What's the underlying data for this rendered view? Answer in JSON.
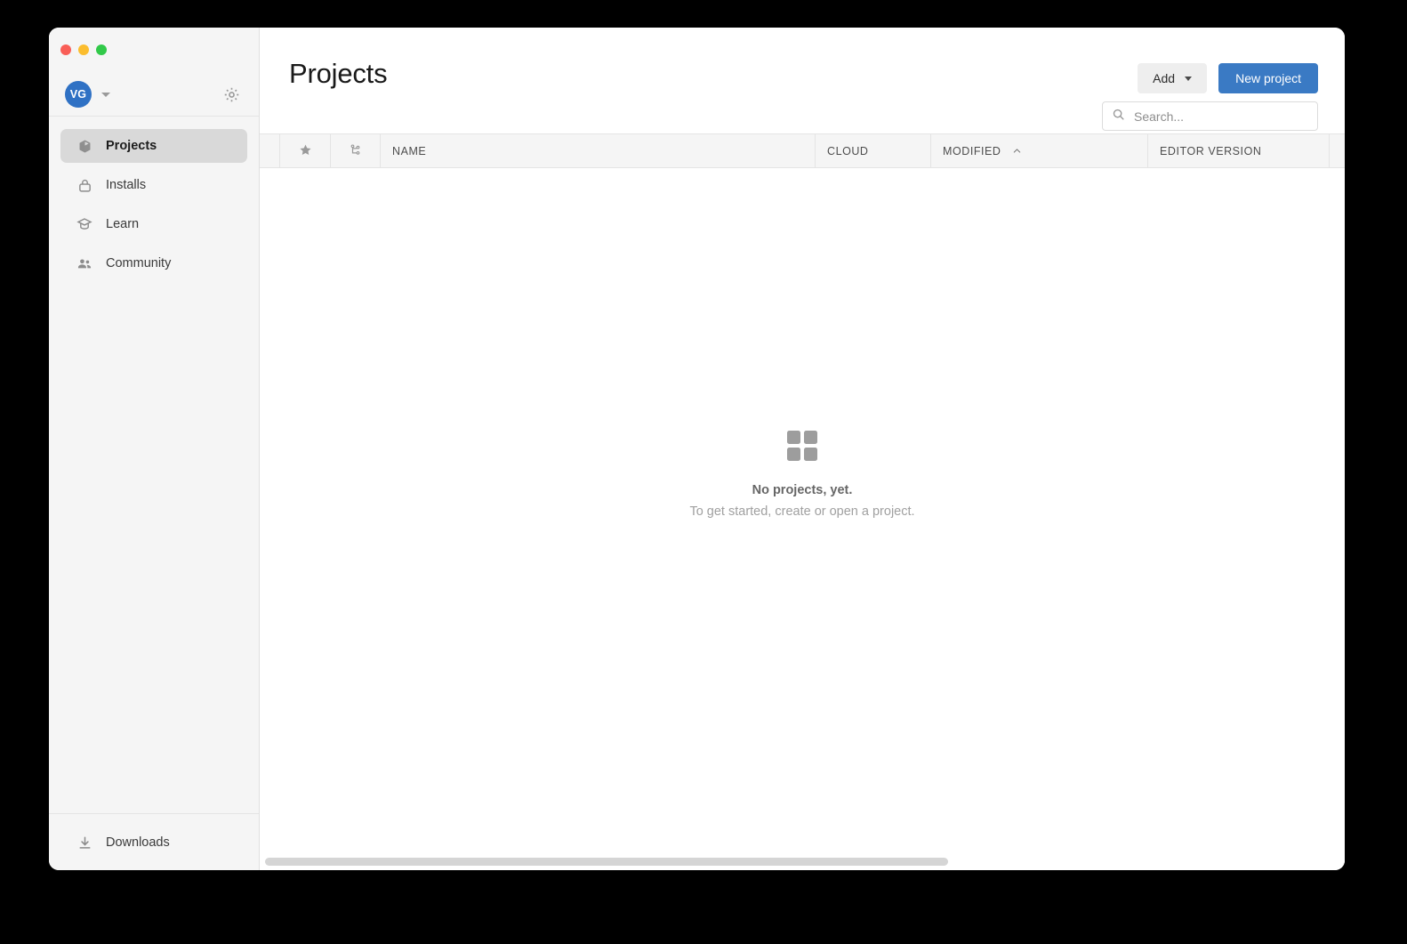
{
  "window": {
    "traffic_lights": [
      {
        "name": "close",
        "color": "#f95e57"
      },
      {
        "name": "minimize",
        "color": "#fbbd2e"
      },
      {
        "name": "maximize",
        "color": "#31c949"
      }
    ]
  },
  "sidebar": {
    "account": {
      "avatar_initials": "VG",
      "avatar_color": "#2f71c4",
      "caret_icon": "chevron-down-icon",
      "settings_icon": "gear-icon"
    },
    "items": [
      {
        "label": "Projects",
        "icon": "cube-icon",
        "active": true
      },
      {
        "label": "Installs",
        "icon": "lock-icon",
        "active": false
      },
      {
        "label": "Learn",
        "icon": "graduation-cap-icon",
        "active": false
      },
      {
        "label": "Community",
        "icon": "people-icon",
        "active": false
      }
    ],
    "footer": {
      "label": "Downloads",
      "icon": "download-icon"
    }
  },
  "main": {
    "title": "Projects",
    "actions": {
      "add_label": "Add",
      "add_caret_icon": "chevron-down-icon",
      "new_project_label": "New project",
      "new_project_color": "#3a7ac4"
    },
    "search": {
      "placeholder": "Search...",
      "value": "",
      "icon": "search-icon"
    },
    "table": {
      "columns": [
        {
          "label": "",
          "icon": "star-icon",
          "type": "icon"
        },
        {
          "label": "",
          "icon": "git-branch-icon",
          "type": "icon"
        },
        {
          "label": "NAME",
          "icon": "",
          "type": "text"
        },
        {
          "label": "CLOUD",
          "icon": "",
          "type": "text"
        },
        {
          "label": "MODIFIED",
          "icon": "chevron-up-icon",
          "type": "text",
          "sorted": "asc"
        },
        {
          "label": "EDITOR VERSION",
          "icon": "",
          "type": "text"
        },
        {
          "label": "",
          "icon": "",
          "type": "text"
        }
      ],
      "rows": []
    },
    "empty_state": {
      "icon": "grid-squares-icon",
      "title": "No projects, yet.",
      "subtitle": "To get started, create or open a project."
    },
    "scrollbar": {
      "orientation": "horizontal",
      "thumb_color": "#d5d5d5"
    }
  }
}
